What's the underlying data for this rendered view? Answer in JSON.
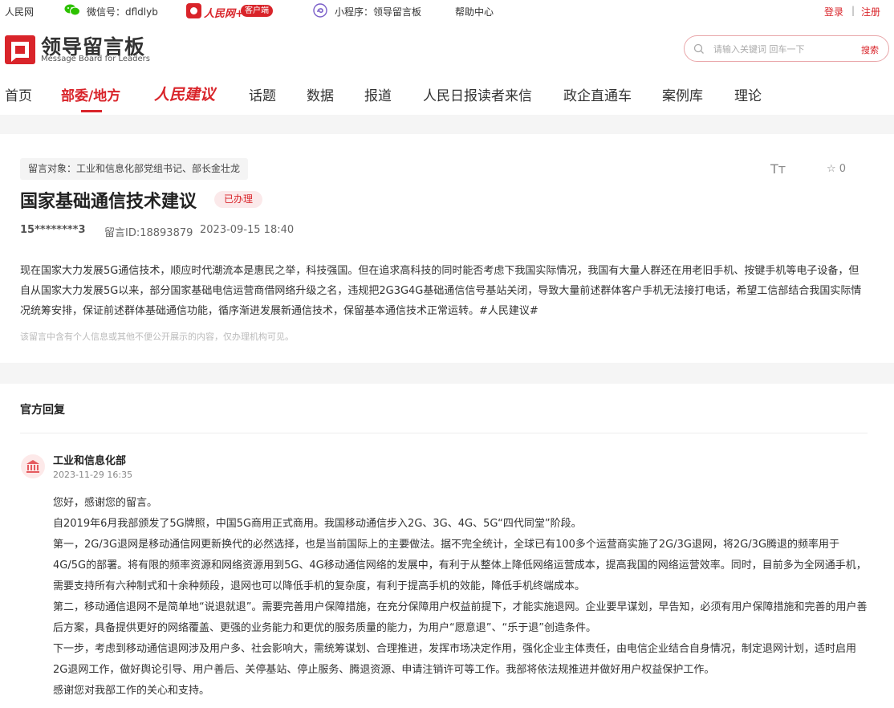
{
  "topbar": {
    "site_name": "人民网",
    "wechat_label": "微信号：dfldlyb",
    "app_brand": "人民网+",
    "app_tag": "客户端",
    "miniprogram_label": "小程序：领导留言板",
    "help": "帮助中心",
    "login": "登录",
    "separator": "|",
    "register": "注册"
  },
  "header": {
    "logo_title": "领导留言板",
    "logo_subtitle": "Message Board for Leaders",
    "search_placeholder": "请输入关键词 回车一下",
    "search_button": "搜索"
  },
  "nav": {
    "items": [
      "首页",
      "部委/地方",
      "人民建议",
      "话题",
      "数据",
      "报道",
      "人民日报读者来信",
      "政企直通车",
      "案例库",
      "理论"
    ]
  },
  "message": {
    "to_label": "留言对象：工业和信息化部党组书记、部长金壮龙",
    "font_icon_text": "Tт",
    "favorites": "☆ 0",
    "title": "国家基础通信技术建议",
    "status": "已办理",
    "user": "15********3",
    "message_id": "留言ID:18893879",
    "datetime": "2023-09-15 18:40",
    "body": "现在国家大力发展5G通信技术，顺应时代潮流本是惠民之举，科技强国。但在追求高科技的同时能否考虑下我国实际情况，我国有大量人群还在用老旧手机、按键手机等电子设备，但自从国家大力发展5G以来，部分国家基础电信运营商借网络升级之名，违规把2G3G4G基础通信信号基站关闭，导致大量前述群体客户手机无法接打电话，希望工信部结合我国实际情况统筹安排，保证前述群体基础通信功能，循序渐进发展新通信技术，保留基本通信技术正常运转。#人民建议#",
    "privacy_note": "该留言中含有个人信息或其他不便公开展示的内容，仅办理机构可见。"
  },
  "reply": {
    "heading": "官方回复",
    "department": "工业和信息化部",
    "date": "2023-11-29 16:35",
    "paragraphs": [
      "您好，感谢您的留言。",
      "自2019年6月我部颁发了5G牌照，中国5G商用正式商用。我国移动通信步入2G、3G、4G、5G“四代同堂”阶段。",
      "第一，2G/3G退网是移动通信网更新换代的必然选择，也是当前国际上的主要做法。据不完全统计，全球已有100多个运营商实施了2G/3G退网，将2G/3G腾退的频率用于4G/5G的部署。将有限的频率资源和网络资源用到5G、4G移动通信网络的发展中，有利于从整体上降低网络运营成本，提高我国的网络运营效率。同时，目前多为全网通手机，需要支持所有六种制式和十余种频段，退网也可以降低手机的复杂度，有利于提高手机的效能，降低手机终端成本。",
      "第二，移动通信退网不是简单地“说退就退”。需要完善用户保障措施，在充分保障用户权益前提下，才能实施退网。企业要早谋划，早告知，必须有用户保障措施和完善的用户善后方案，具备提供更好的网络覆盖、更强的业务能力和更优的服务质量的能力，为用户“愿意退”、“乐于退”创造条件。",
      "下一步，考虑到移动通信退网涉及用户多、社会影响大，需统筹谋划、合理推进，发挥市场决定作用，强化企业主体责任，由电信企业结合自身情况，制定退网计划，适时启用2G退网工作，做好舆论引导、用户善后、关停基站、停止服务、腾退资源、申请注销许可等工作。我部将依法规推进并做好用户权益保护工作。",
      "感谢您对我部工作的关心和支持。"
    ]
  },
  "colors": {
    "accent": "#d9242a",
    "band": "#f5f5f5"
  }
}
